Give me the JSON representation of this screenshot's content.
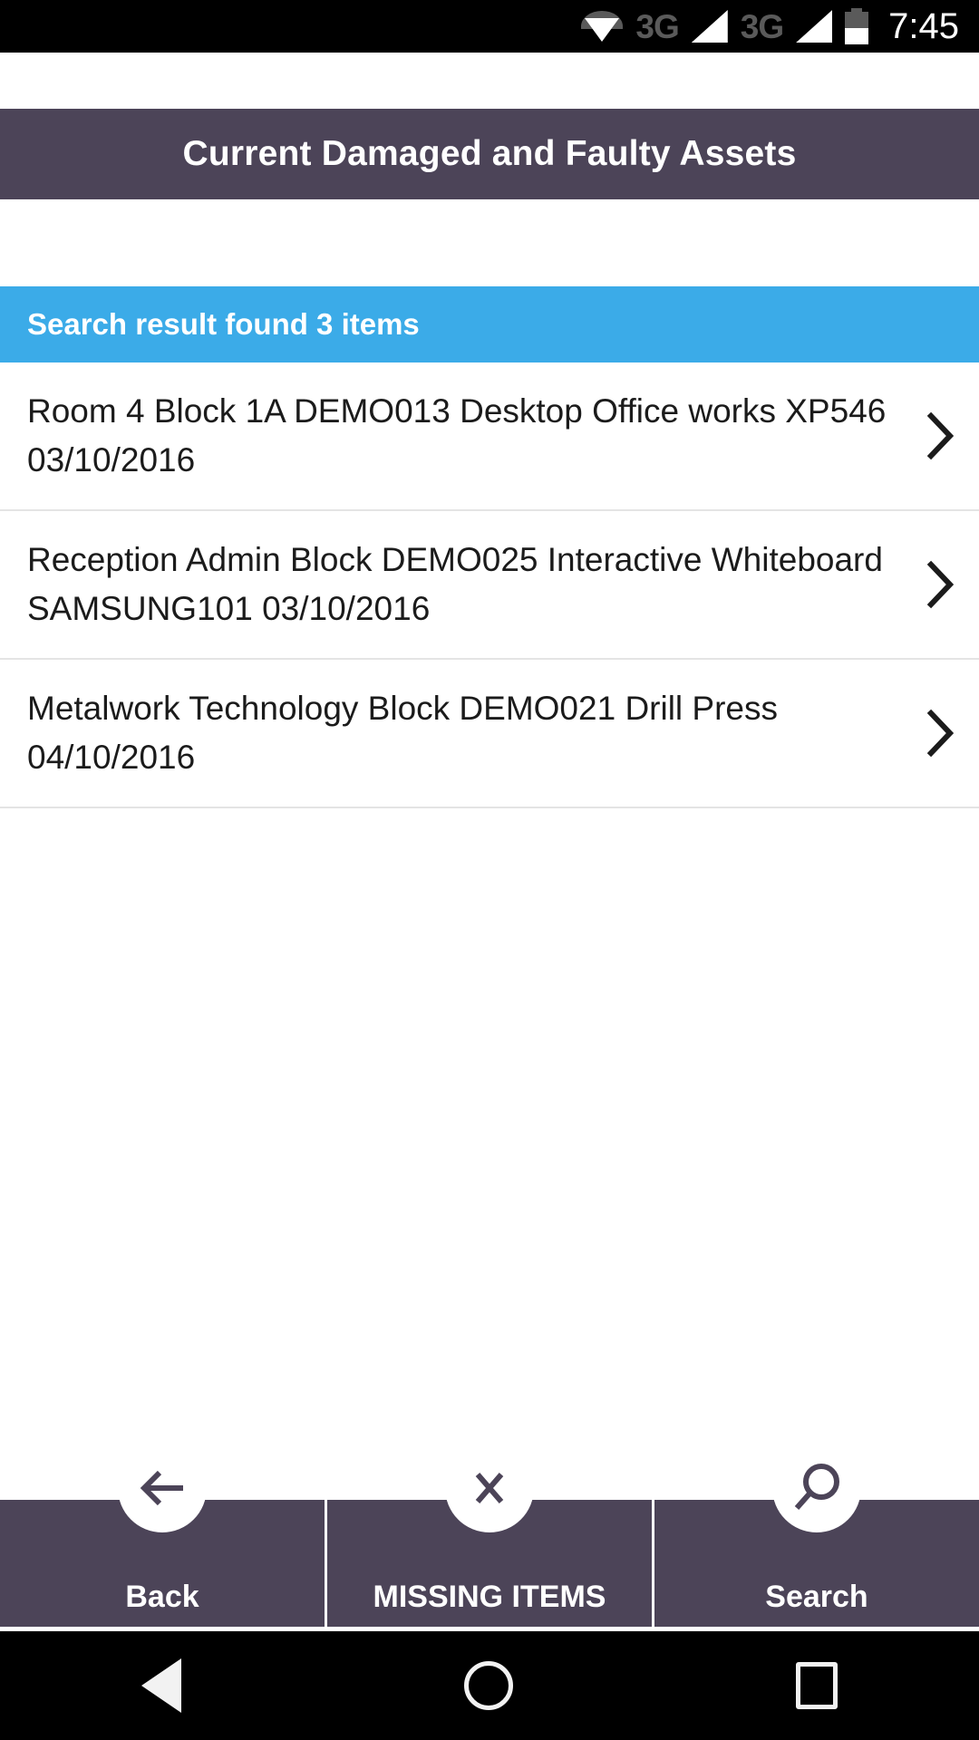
{
  "status_bar": {
    "wifi_icon": "wifi-icon",
    "network_label_1": "3G",
    "signal_icon_1": "signal-bars-icon",
    "network_label_2": "3G",
    "signal_icon_2": "signal-bars-icon",
    "battery_icon": "battery-half-icon",
    "time": "7:45"
  },
  "app_bar": {
    "title": "Current Damaged and Faulty Assets",
    "background_color": "#4c4458"
  },
  "banner": {
    "text": "Search result found 3 items",
    "background_color": "#3babe8",
    "result_count": 3
  },
  "list": {
    "items": [
      {
        "text": "Room 4 Block 1A DEMO013 Desktop Office works XP546 03/10/2016",
        "location": "Room 4 Block 1A",
        "asset_id": "DEMO013",
        "description": "Desktop Office works",
        "serial": "XP546",
        "date": "03/10/2016",
        "chevron": "chevron-right-icon"
      },
      {
        "text": "Reception Admin Block DEMO025 Interactive Whiteboard  SAMSUNG101 03/10/2016",
        "location": "Reception Admin Block",
        "asset_id": "DEMO025",
        "description": "Interactive Whiteboard",
        "serial": "SAMSUNG101",
        "date": "03/10/2016",
        "chevron": "chevron-right-icon"
      },
      {
        "text": "Metalwork Technology Block DEMO021 Drill Press  04/10/2016",
        "location": "Metalwork Technology Block",
        "asset_id": "DEMO021",
        "description": "Drill Press",
        "serial": "",
        "date": "04/10/2016",
        "chevron": "chevron-right-icon"
      }
    ]
  },
  "action_bar": {
    "background_color": "#4c4458",
    "actions": [
      {
        "label": "Back",
        "icon": "arrow-left-icon"
      },
      {
        "label": "MISSING ITEMS",
        "icon": "close-x-icon"
      },
      {
        "label": "Search",
        "icon": "search-icon"
      }
    ]
  },
  "navigation_bar": {
    "back": "android-back-icon",
    "home": "android-home-icon",
    "recents": "android-recents-icon"
  }
}
